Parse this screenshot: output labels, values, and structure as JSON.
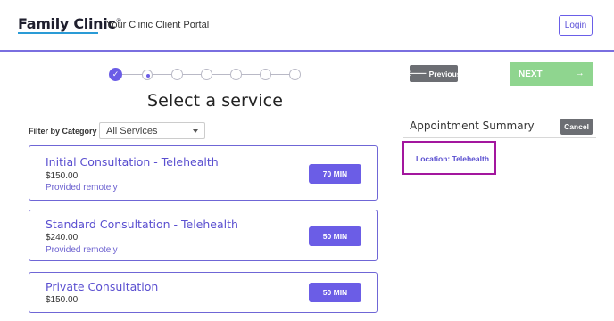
{
  "header": {
    "logo_text": "Family Clinic",
    "logo_mark": "®",
    "portal_title": "Your Clinic Client Portal",
    "login_label": "Login"
  },
  "stepper": {
    "current_step": 2,
    "total_steps": 7
  },
  "page": {
    "title": "Select a service"
  },
  "filter": {
    "label": "Filter by Category",
    "selected": "All Services"
  },
  "services": [
    {
      "name": "Initial Consultation - Telehealth",
      "price": "$150.00",
      "note": "Provided remotely",
      "duration": "70 MIN"
    },
    {
      "name": "Standard Consultation - Telehealth",
      "price": "$240.00",
      "note": "Provided remotely",
      "duration": "50 MIN"
    },
    {
      "name": "Private Consultation",
      "price": "$150.00",
      "note": "",
      "duration": "50 MIN"
    }
  ],
  "nav": {
    "previous_label": "Previous",
    "previous_icon": "arrow-left-icon",
    "next_label": "NEXT",
    "next_icon": "arrow-right-icon"
  },
  "summary": {
    "title": "Appointment Summary",
    "cancel_label": "Cancel",
    "location": "Location: Telehealth"
  },
  "colors": {
    "accent": "#6b5de6",
    "next_button": "#8fd58f",
    "gray_button": "#6c6e73",
    "highlight_border": "#a3169e"
  }
}
